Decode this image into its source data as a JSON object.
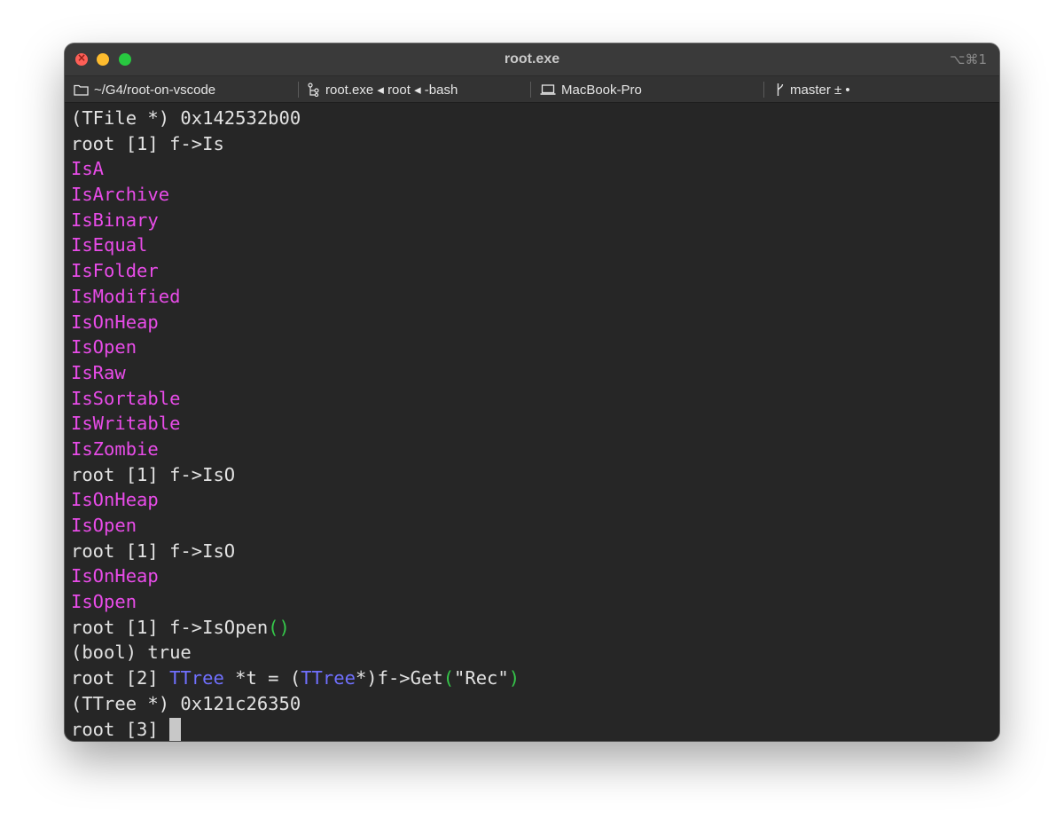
{
  "window": {
    "title": "root.exe",
    "shortcut": "⌥⌘1"
  },
  "statusbar": {
    "directory": "~/G4/root-on-vscode",
    "process": "root.exe ◂ root ◂ -bash",
    "host": "MacBook-Pro",
    "branch": "master ± •"
  },
  "terminal": {
    "lines": [
      {
        "text": "(TFile *) 0x142532b00"
      },
      {
        "text": "root [1] f->Is"
      },
      {
        "completion": "IsA"
      },
      {
        "completion": "IsArchive"
      },
      {
        "completion": "IsBinary"
      },
      {
        "completion": "IsEqual"
      },
      {
        "completion": "IsFolder"
      },
      {
        "completion": "IsModified"
      },
      {
        "completion": "IsOnHeap"
      },
      {
        "completion": "IsOpen"
      },
      {
        "completion": "IsRaw"
      },
      {
        "completion": "IsSortable"
      },
      {
        "completion": "IsWritable"
      },
      {
        "completion": "IsZombie"
      },
      {
        "text": "root [1] f->IsO"
      },
      {
        "completion": "IsOnHeap"
      },
      {
        "completion": "IsOpen"
      },
      {
        "text": "root [1] f->IsO"
      },
      {
        "completion": "IsOnHeap"
      },
      {
        "completion": "IsOpen"
      },
      {
        "prompt": "root [1] f->IsOpen",
        "open_paren": "(",
        "close_paren": ")"
      },
      {
        "text": "(bool) true"
      },
      {
        "p1": "root [2] ",
        "type1": "TTree",
        "p2": " *t = (",
        "type2": "TTree",
        "p3": "*)f->Get",
        "open_paren": "(",
        "arg": "\"Rec\"",
        "close_paren": ")"
      },
      {
        "text": "(TTree *) 0x121c26350"
      },
      {
        "prompt": "root [3] "
      }
    ]
  },
  "colors": {
    "completion": "#e84ce8",
    "type_keyword": "#7070ff",
    "paren": "#35c84a",
    "background": "#262626",
    "foreground": "#e2e2e2"
  }
}
